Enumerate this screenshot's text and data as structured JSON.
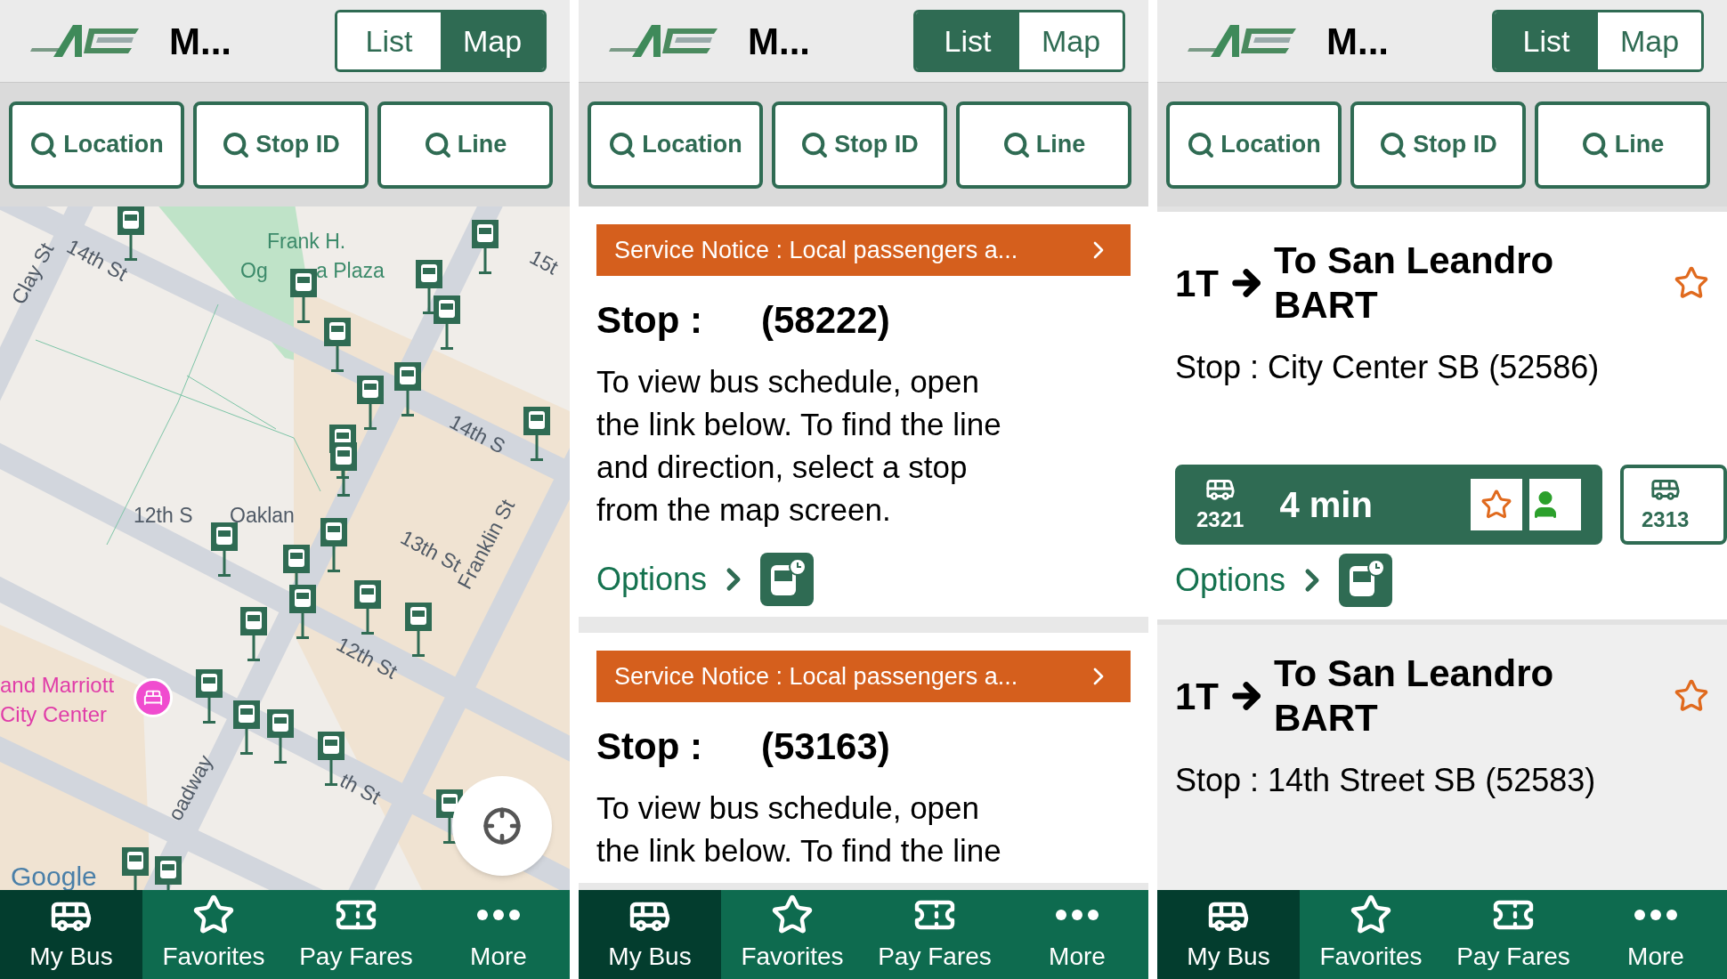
{
  "screens": [
    {
      "kind": "map",
      "title": "M...",
      "segments": [
        {
          "label": "List",
          "selected": false
        },
        {
          "label": "Map",
          "selected": true
        }
      ],
      "search_buttons": [
        "Location",
        "Stop ID",
        "Line"
      ],
      "map": {
        "labels": [
          "14th St",
          "Frank H.",
          "Og",
          "a Plaza",
          "Clay St",
          "15t",
          "14th S",
          "12th S",
          "Oaklan",
          "13th St",
          "Franklin St",
          "12th St",
          "th St",
          "oadway"
        ],
        "hotel_labels": [
          "and Marriott",
          "City Center"
        ],
        "attribution": "Google"
      },
      "nav": [
        {
          "label": "My Bus",
          "selected": true
        },
        {
          "label": "Favorites",
          "selected": false
        },
        {
          "label": "Pay Fares",
          "selected": false
        },
        {
          "label": "More",
          "selected": false
        }
      ]
    },
    {
      "kind": "notices",
      "title": "M...",
      "segments": [
        {
          "label": "List",
          "selected": true
        },
        {
          "label": "Map",
          "selected": false
        }
      ],
      "search_buttons": [
        "Location",
        "Stop ID",
        "Line"
      ],
      "notices": [
        {
          "notice": "Service Notice : Local passengers a...",
          "stop_label": "Stop :",
          "stop_id": "(58222)",
          "text": "To view bus schedule, open the link below. To find the line and direction, select a stop from the map screen.",
          "options": "Options"
        },
        {
          "notice": "Service Notice : Local passengers a...",
          "stop_label": "Stop :",
          "stop_id": "(53163)",
          "text": "To view bus schedule, open the link below. To find the line"
        }
      ],
      "nav": [
        {
          "label": "My Bus",
          "selected": true
        },
        {
          "label": "Favorites",
          "selected": false
        },
        {
          "label": "Pay Fares",
          "selected": false
        },
        {
          "label": "More",
          "selected": false
        }
      ]
    },
    {
      "kind": "arrivals",
      "title": "M...",
      "segments": [
        {
          "label": "List",
          "selected": true
        },
        {
          "label": "Map",
          "selected": false
        }
      ],
      "search_buttons": [
        "Location",
        "Stop ID",
        "Line"
      ],
      "arrivals": [
        {
          "line": "1T",
          "destination": "To San Leandro BART",
          "stop": "Stop : City Center SB (52586)",
          "favorite": false,
          "buses": [
            {
              "vehicle": "2321",
              "eta": "4 min",
              "selected": true
            },
            {
              "vehicle": "2313",
              "selected": false
            }
          ],
          "options": "Options"
        },
        {
          "line": "1T",
          "destination": "To San Leandro BART",
          "stop": "Stop : 14th Street SB (52583)",
          "favorite": false
        }
      ],
      "nav": [
        {
          "label": "My Bus",
          "selected": true
        },
        {
          "label": "Favorites",
          "selected": false
        },
        {
          "label": "Pay Fares",
          "selected": false
        },
        {
          "label": "More",
          "selected": false
        }
      ]
    }
  ]
}
